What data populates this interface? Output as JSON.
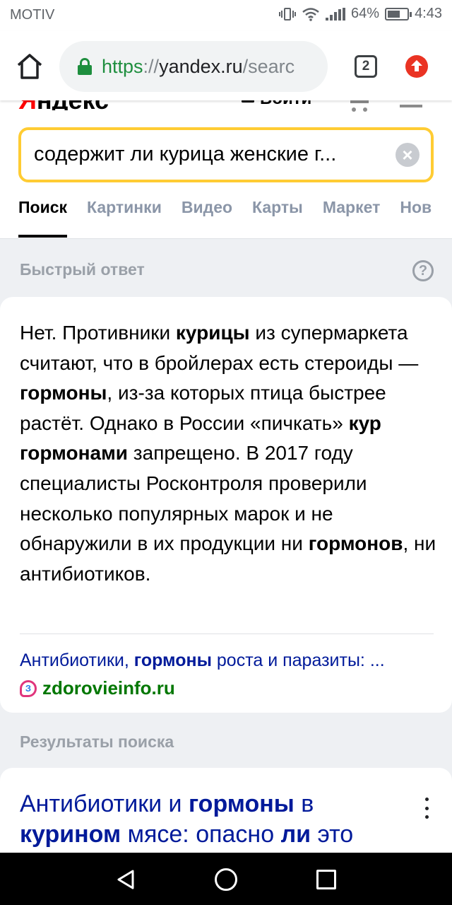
{
  "status_bar": {
    "carrier": "MOTIV",
    "battery": "64%",
    "battery_level": 0.64,
    "time": "4:43"
  },
  "browser": {
    "url_scheme": "https",
    "url_sep": "://",
    "url_host": "yandex.ru",
    "url_rest": "/searc",
    "tab_count": "2",
    "icons": [
      "home-icon",
      "lock-icon",
      "update-icon"
    ]
  },
  "yandex": {
    "logo_first": "Я",
    "logo_rest": "ндекс",
    "login_label": "Войти",
    "query": "содержит ли курица женские г...",
    "clear_symbol": "×",
    "tabs": [
      "Поиск",
      "Картинки",
      "Видео",
      "Карты",
      "Маркет",
      "Нов"
    ],
    "active_tab": "Поиск"
  },
  "quick_answer": {
    "label": "Быстрый ответ",
    "help_symbol": "?",
    "segments": [
      {
        "t": "Нет. Противники ",
        "b": false
      },
      {
        "t": "курицы",
        "b": true
      },
      {
        "t": " из супермаркета считают, что в бройлерах есть стероиды — ",
        "b": false
      },
      {
        "t": "гормоны",
        "b": true
      },
      {
        "t": ", из-за которых птица быстрее растёт. Однако в России «пичкать» ",
        "b": false
      },
      {
        "t": "кур гормонами",
        "b": true
      },
      {
        "t": " запрещено. В 2017 году специалисты Росконтроля проверили несколько популярных марок и не обнаружили в их продукции ни ",
        "b": false
      },
      {
        "t": "гормонов",
        "b": true
      },
      {
        "t": ", ни антибиотиков.",
        "b": false
      }
    ],
    "source_title_pre": "Антибиотики, ",
    "source_title_bold": "гормоны",
    "source_title_post": " роста и паразиты: ...",
    "favicon_letter": "З",
    "source_host": "zdorovieinfo.ru"
  },
  "results": {
    "label": "Результаты поиска",
    "first_title_segments": [
      {
        "t": "Антибиотики и ",
        "b": false
      },
      {
        "t": "гормоны",
        "b": true
      },
      {
        "t": " в ",
        "b": false
      },
      {
        "t": "курином",
        "b": true
      },
      {
        "t": " мясе: опасно ",
        "b": false
      },
      {
        "t": "ли",
        "b": true
      },
      {
        "t": " это",
        "b": false
      }
    ]
  },
  "colors": {
    "accent_yellow": "#ffcc33",
    "link_blue": "#001a9a",
    "host_green": "#007700",
    "secure_green": "#1e8e3e"
  }
}
